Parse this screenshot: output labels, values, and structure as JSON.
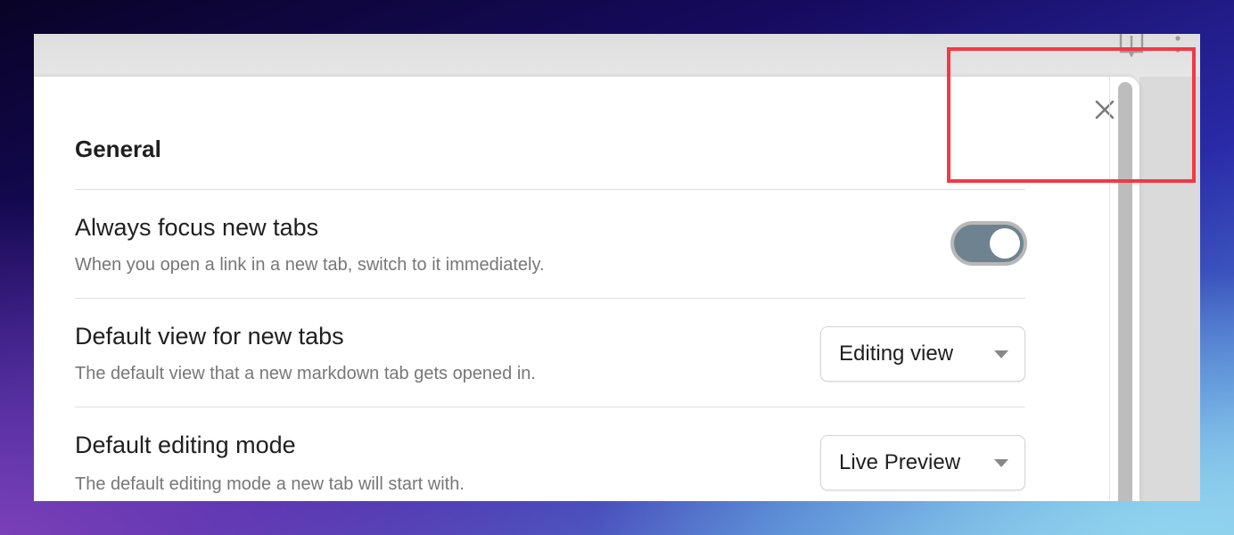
{
  "toolbar": {
    "book_icon": "book-open-icon",
    "more_icon": "vertical-ellipsis-icon"
  },
  "modal": {
    "close_icon": "close-icon",
    "section_title": "General",
    "settings": [
      {
        "name": "Always focus new tabs",
        "description": "When you open a link in a new tab, switch to it immediately.",
        "control": "toggle",
        "enabled": true
      },
      {
        "name": "Default view for new tabs",
        "description": "The default view that a new markdown tab gets opened in.",
        "control": "select",
        "value": "Editing view"
      },
      {
        "name": "Default editing mode",
        "description": "The default editing mode a new tab will start with.",
        "control": "select",
        "value": "Live Preview"
      }
    ]
  },
  "colors": {
    "toggle_on": "#6e838f",
    "highlight_box": "#f03a46"
  }
}
